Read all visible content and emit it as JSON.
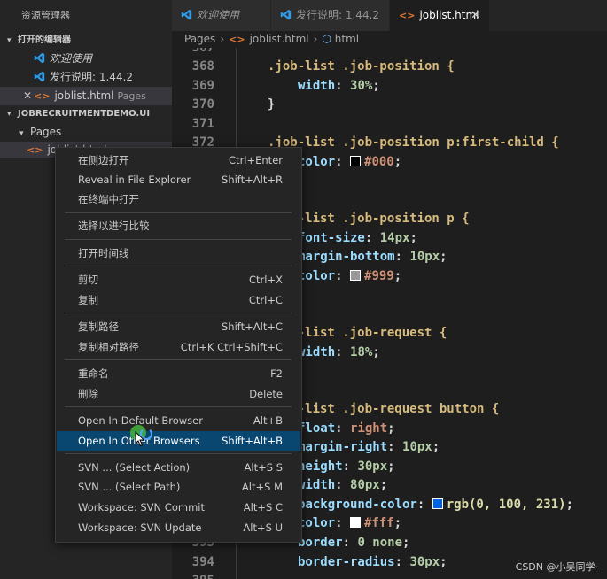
{
  "sidebar": {
    "title": "资源管理器",
    "open_editors_header": "打开的编辑器",
    "open_editors": [
      {
        "label": "欢迎使用",
        "extra": ""
      },
      {
        "label": "发行说明: 1.44.2",
        "extra": ""
      },
      {
        "label": "joblist.html",
        "extra": "Pages"
      }
    ],
    "project_header": "JOBRECRUITMENTDEMO.UI",
    "folder": "Pages",
    "file": "joblist.html"
  },
  "tabs": [
    {
      "label": "欢迎使用"
    },
    {
      "label": "发行说明: 1.44.2"
    },
    {
      "label": "joblist.html"
    }
  ],
  "breadcrumb": {
    "folder": "Pages",
    "file": "joblist.html",
    "node": "html"
  },
  "editor": {
    "line_numbers": [
      "367",
      "368",
      "369",
      "370",
      "371",
      "372",
      "",
      "",
      "",
      "",
      "",
      "",
      "",
      "",
      "",
      "",
      "",
      "",
      "",
      "",
      "",
      "",
      "",
      "",
      "",
      "",
      "",
      "393",
      "394",
      "395"
    ],
    "lines": {
      "l1": ".job-list .job-position {",
      "l2_prop": "width",
      "l2_val": "30%",
      "l3": "}",
      "l4": ".job-list .job-position p:first-child {",
      "l5_prop": "color",
      "l5_val": "#000",
      "l6": ".job-list .job-position p {",
      "l7_prop": "font-size",
      "l7_val": "14px",
      "l8_prop": "margin-bottom",
      "l8_val": "10px",
      "l9_prop": "color",
      "l9_val": "#999",
      "l10": ".job-list .job-request {",
      "l11_prop": "width",
      "l11_val": "18%",
      "l12": ".job-list .job-request button {",
      "l13_prop": "float",
      "l13_val": "right",
      "l14_prop": "margin-right",
      "l14_val": "10px",
      "l15_prop": "height",
      "l15_val": "30px",
      "l16_prop": "width",
      "l16_val": "80px",
      "l17_prop": "background-color",
      "l17_val": "rgb(0, 100, 231)",
      "l18_prop": "color",
      "l18_val": "#fff",
      "l19_prop": "border",
      "l19_val": "0 none",
      "l20_prop": "border-radius",
      "l20_val": "30px"
    }
  },
  "context_menu": {
    "items": [
      {
        "label": "在侧边打开",
        "key": "Ctrl+Enter"
      },
      {
        "label": "Reveal in File Explorer",
        "key": "Shift+Alt+R"
      },
      {
        "label": "在终端中打开",
        "key": ""
      },
      {
        "label": "选择以进行比较",
        "key": ""
      },
      {
        "label": "打开时间线",
        "key": ""
      },
      {
        "label": "剪切",
        "key": "Ctrl+X"
      },
      {
        "label": "复制",
        "key": "Ctrl+C"
      },
      {
        "label": "复制路径",
        "key": "Shift+Alt+C"
      },
      {
        "label": "复制相对路径",
        "key": "Ctrl+K Ctrl+Shift+C"
      },
      {
        "label": "重命名",
        "key": "F2"
      },
      {
        "label": "删除",
        "key": "Delete"
      },
      {
        "label": "Open In Default Browser",
        "key": "Alt+B"
      },
      {
        "label": "Open In Other Browsers",
        "key": "Shift+Alt+B"
      },
      {
        "label": "SVN ... (Select Action)",
        "key": "Alt+S S"
      },
      {
        "label": "SVN ... (Select Path)",
        "key": "Alt+S M"
      },
      {
        "label": "Workspace: SVN Commit",
        "key": "Alt+S C"
      },
      {
        "label": "Workspace: SVN Update",
        "key": "Alt+S U"
      }
    ],
    "highlighted_index": 12
  },
  "colors": {
    "accent_vscode": "#007acc",
    "menu_highlight": "#094771",
    "html_icon": "#e37933"
  },
  "watermark": "CSDN @小吴同学·"
}
